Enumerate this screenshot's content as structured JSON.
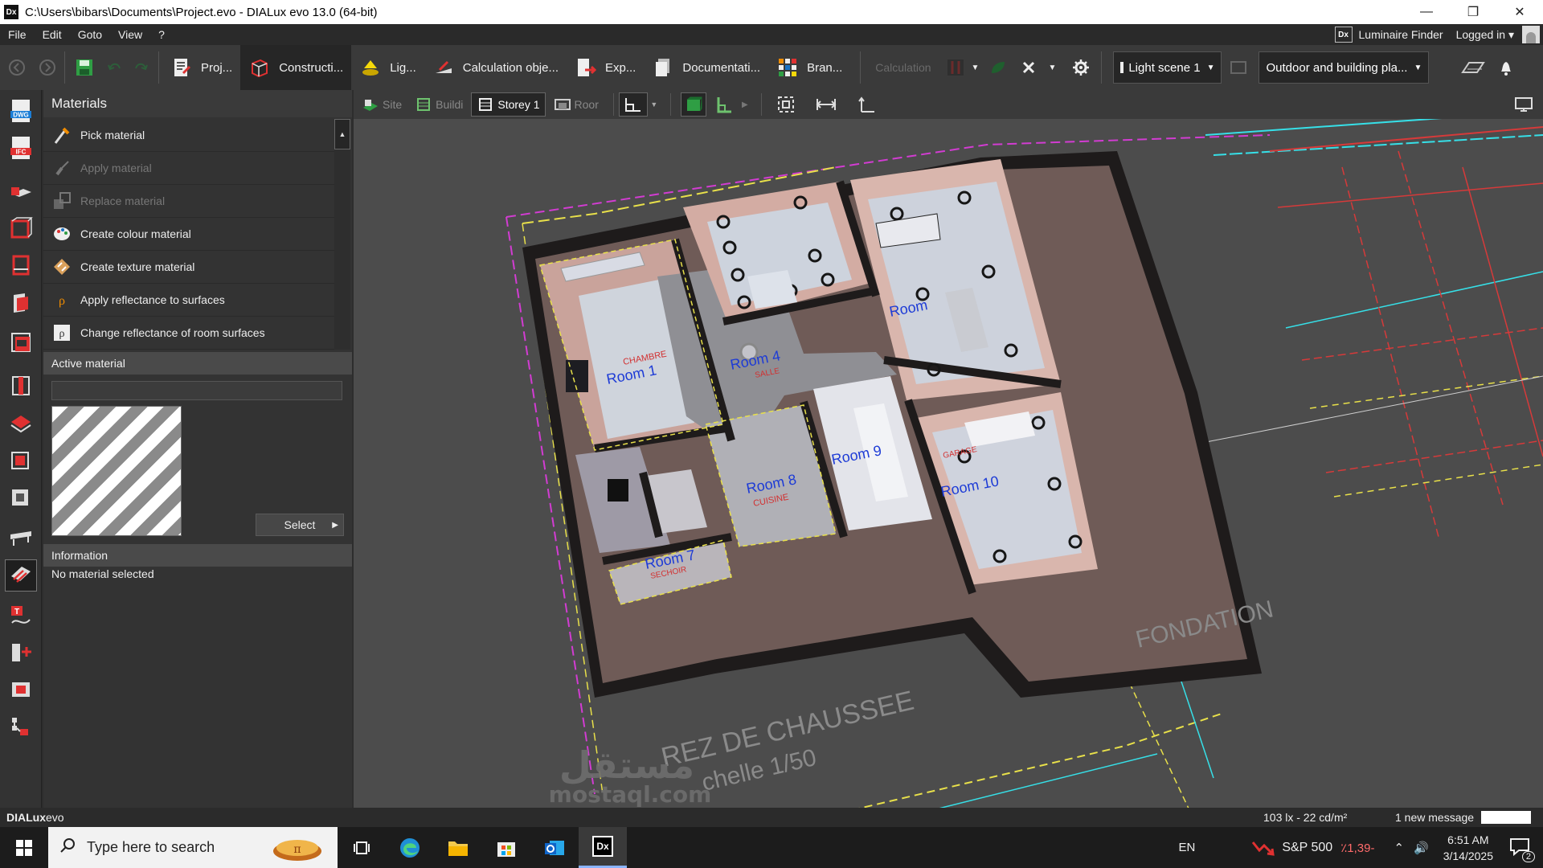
{
  "titlebar": {
    "app_icon": "Dx",
    "title": "C:\\Users\\bibars\\Documents\\Project.evo - DIALux evo 13.0  (64-bit)",
    "icons": [
      "minimize-icon",
      "restore-icon",
      "close-icon"
    ]
  },
  "menubar": {
    "items": [
      "File",
      "Edit",
      "Goto",
      "View",
      "?"
    ],
    "badge": "Dx",
    "luminaire_finder": "Luminaire Finder",
    "logged_in": "Logged in"
  },
  "ribbon": {
    "tabs": [
      {
        "label": "Proj...",
        "icon": "project-icon"
      },
      {
        "label": "Constructi...",
        "icon": "construction-icon",
        "active": true
      },
      {
        "label": "Lig...",
        "icon": "light-icon"
      },
      {
        "label": "Calculation obje...",
        "icon": "calculation-objects-icon"
      },
      {
        "label": "Exp...",
        "icon": "export-icon"
      },
      {
        "label": "Documentati...",
        "icon": "documentation-icon"
      },
      {
        "label": "Bran...",
        "icon": "brand-icon"
      }
    ],
    "calculation": "Calculation",
    "light_scene": "Light scene 1",
    "view_mode": "Outdoor and building pla..."
  },
  "materials_panel": {
    "title": "Materials",
    "actions": [
      {
        "label": "Pick material",
        "icon": "pipette-icon",
        "enabled": true
      },
      {
        "label": "Apply material",
        "icon": "brush-icon",
        "enabled": false
      },
      {
        "label": "Replace material",
        "icon": "replace-icon",
        "enabled": false
      },
      {
        "label": "Create colour material",
        "icon": "palette-icon",
        "enabled": true
      },
      {
        "label": "Create texture material",
        "icon": "texture-icon",
        "enabled": true
      },
      {
        "label": "Apply reflectance to surfaces",
        "icon": "reflectance-icon",
        "enabled": true
      },
      {
        "label": "Change reflectance of room surfaces",
        "icon": "room-reflectance-icon",
        "enabled": true
      }
    ],
    "active_material_title": "Active material",
    "active_material_name": "",
    "select_label": "Select",
    "information_title": "Information",
    "information_text": "No material selected"
  },
  "viewport": {
    "tabs": [
      {
        "label": "Site",
        "icon": "site-icon"
      },
      {
        "label": "Buildi",
        "icon": "building-icon"
      },
      {
        "label": "Storey 1",
        "icon": "storey-icon",
        "active": true
      },
      {
        "label": "Roor",
        "icon": "room-icon"
      }
    ],
    "rooms": [
      "Room 1",
      "Room 4",
      "Room",
      "Room 7",
      "Room 8",
      "Room 9",
      "Room 10"
    ],
    "room_sublabels": [
      "CHAMBRE",
      "SALLE",
      "CUISINE",
      "SECHOIR",
      "GARAGE"
    ],
    "plan_text": [
      "REZ DE CHAUSSEE",
      "chelle 1/50",
      "FONDATION"
    ],
    "watermark": {
      "arabic": "مستقل",
      "latin": "mostaql.com"
    }
  },
  "statusbar": {
    "brand_a": "DIALux",
    "brand_b": "evo",
    "lux": "103 lx - 22 cd/m²",
    "messages": "1 new message"
  },
  "taskbar": {
    "search_placeholder": "Type here to search",
    "lang": "EN",
    "stock_name": "S&P 500",
    "stock_change": "٪1,39-",
    "time": "6:51 AM",
    "date": "3/14/2025",
    "notifications": "2"
  }
}
